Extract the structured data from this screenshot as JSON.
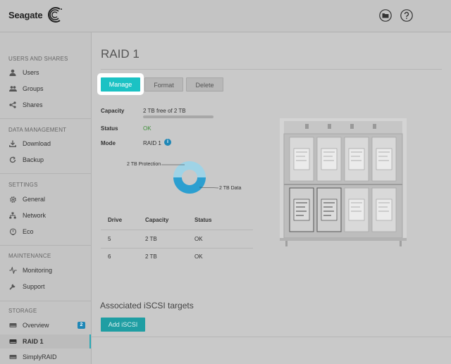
{
  "header": {
    "logo_text": "Seagate",
    "folder_icon": "folder-icon",
    "help_icon": "help-icon"
  },
  "sidebar": {
    "sections": [
      {
        "title": "USERS AND SHARES",
        "items": [
          {
            "label": "Users",
            "icon": "user-icon"
          },
          {
            "label": "Groups",
            "icon": "groups-icon"
          },
          {
            "label": "Shares",
            "icon": "share-icon"
          }
        ]
      },
      {
        "title": "DATA MANAGEMENT",
        "items": [
          {
            "label": "Download",
            "icon": "download-icon"
          },
          {
            "label": "Backup",
            "icon": "backup-icon"
          }
        ]
      },
      {
        "title": "SETTINGS",
        "items": [
          {
            "label": "General",
            "icon": "gear-icon"
          },
          {
            "label": "Network",
            "icon": "network-icon"
          },
          {
            "label": "Eco",
            "icon": "eco-icon"
          }
        ]
      },
      {
        "title": "MAINTENANCE",
        "items": [
          {
            "label": "Monitoring",
            "icon": "monitoring-icon"
          },
          {
            "label": "Support",
            "icon": "support-icon"
          }
        ]
      },
      {
        "title": "STORAGE",
        "items": [
          {
            "label": "Overview",
            "icon": "drive-icon",
            "badge": "2"
          },
          {
            "label": "RAID 1",
            "icon": "drive-icon",
            "active": true
          },
          {
            "label": "SimplyRAID",
            "icon": "drive-icon"
          }
        ]
      }
    ]
  },
  "main": {
    "title": "RAID 1",
    "buttons": {
      "manage": "Manage",
      "format": "Format",
      "delete": "Delete"
    },
    "details": {
      "capacity_label": "Capacity",
      "capacity_value": "2 TB free of 2 TB",
      "capacity_used_fraction": 0.0,
      "status_label": "Status",
      "status_value": "OK",
      "mode_label": "Mode",
      "mode_value": "RAID 1"
    },
    "donut": {
      "protection_label": "2 TB Protection",
      "data_label": "2 TB Data",
      "protection_fraction": 0.5,
      "data_fraction": 0.5,
      "protection_color": "#9fd3e6",
      "data_color": "#2c9fd0"
    },
    "drives_table": {
      "headers": [
        "Drive",
        "Capacity",
        "Status"
      ],
      "rows": [
        [
          "5",
          "2 TB",
          "OK"
        ],
        [
          "6",
          "2 TB",
          "OK"
        ]
      ]
    },
    "iscsi": {
      "title": "Associated iSCSI targets",
      "add_button": "Add iSCSI"
    }
  },
  "colors": {
    "accent": "#1bc2c4",
    "ok": "#3f8f3a",
    "badge": "#1f87b6"
  }
}
